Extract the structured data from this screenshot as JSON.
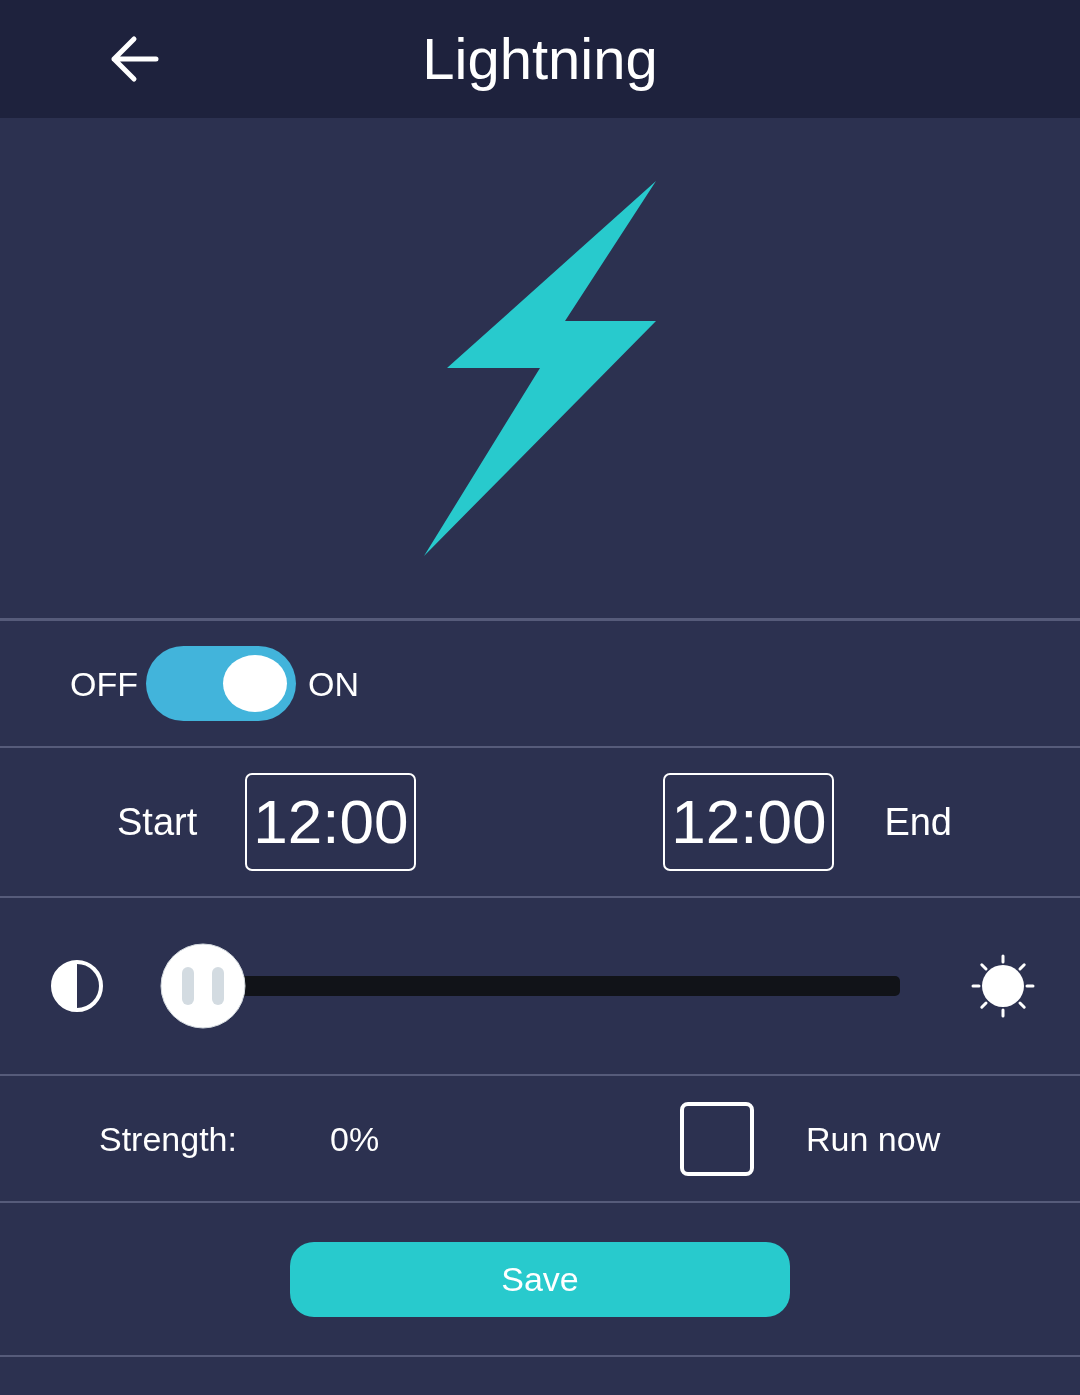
{
  "header": {
    "title": "Lightning"
  },
  "power": {
    "off_label": "OFF",
    "on_label": "ON",
    "on": true
  },
  "schedule": {
    "start_label": "Start",
    "start_time": "12:00",
    "end_time": "12:00",
    "end_label": "End"
  },
  "brightness": {
    "level": 0
  },
  "strength": {
    "label": "Strength:",
    "value": "0%"
  },
  "run_now": {
    "label": "Run now",
    "checked": false
  },
  "save_button": {
    "label": "Save"
  }
}
